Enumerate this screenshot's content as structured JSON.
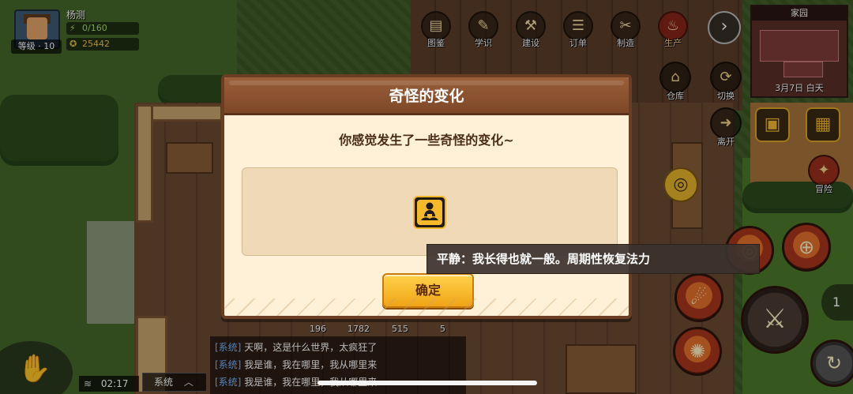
{
  "player": {
    "name": "杨测",
    "level_label": "等级 · 10",
    "energy": "0/160",
    "gold": "25442"
  },
  "toolbar": [
    {
      "label": "图鉴",
      "icon": "book-icon"
    },
    {
      "label": "学识",
      "icon": "scroll-icon"
    },
    {
      "label": "建设",
      "icon": "hammer-icon"
    },
    {
      "label": "订单",
      "icon": "order-icon"
    },
    {
      "label": "制造",
      "icon": "tools-icon"
    },
    {
      "label": "生产",
      "icon": "factory-icon"
    }
  ],
  "minimap": {
    "title": "家园",
    "date": "3月7日  白天"
  },
  "side_buttons": {
    "storage": "仓库",
    "switch": "切换",
    "leave": "离开",
    "adventure": "冒险"
  },
  "dialog": {
    "title": "奇怪的变化",
    "message": "你感觉发生了一些奇怪的变化~",
    "confirm": "确定",
    "effect_icon": "meditation-icon"
  },
  "tooltip": {
    "text": "平静：我长得也就一般。周期性恢复法力"
  },
  "counters": [
    "196",
    "1782",
    "515",
    "5"
  ],
  "chat": {
    "channel": "系统",
    "time": "02:17",
    "lines": [
      {
        "tag": "[系统]",
        "text": "天啊，这是什么世界，太疯狂了"
      },
      {
        "tag": "[系统]",
        "text": "我是谁，我在哪里，我从哪里来"
      },
      {
        "tag": "[系统]",
        "text": "我是谁，我在哪里，我从哪里来"
      }
    ]
  },
  "right_counter": "1",
  "colors": {
    "dialog_header": "#8a5230",
    "dialog_body": "#fff1d8",
    "confirm_button": "#f5b82a",
    "effect_icon": "#f5b92a"
  }
}
